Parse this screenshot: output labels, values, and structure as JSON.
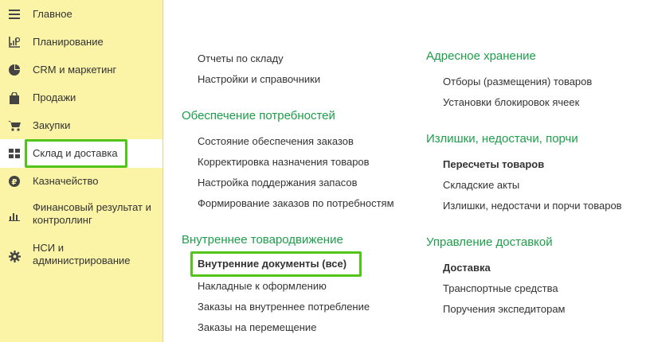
{
  "sidebar": {
    "items": [
      {
        "label": "Главное",
        "icon": "menu-icon"
      },
      {
        "label": "Планирование",
        "icon": "planning-icon"
      },
      {
        "label": "CRM и маркетинг",
        "icon": "pie-chart-icon"
      },
      {
        "label": "Продажи",
        "icon": "shopping-bag-icon"
      },
      {
        "label": "Закупки",
        "icon": "cart-icon"
      },
      {
        "label": "Склад и доставка",
        "icon": "grid-icon"
      },
      {
        "label": "Казначейство",
        "icon": "ruble-icon"
      },
      {
        "label": "Финансовый результат и контроллинг",
        "icon": "bar-chart-icon"
      },
      {
        "label": "НСИ и администрирование",
        "icon": "gear-icon"
      }
    ],
    "active": "Склад и доставка"
  },
  "left_column": {
    "top_links": [
      "Отчеты по складу",
      "Настройки и справочники"
    ],
    "sections": [
      {
        "title": "Обеспечение потребностей",
        "links": [
          "Состояние обеспечения заказов",
          "Корректировка назначения товаров",
          "Настройка поддержания запасов",
          "Формирование заказов по потребностям"
        ]
      },
      {
        "title": "Внутреннее товародвижение",
        "links": [
          "Внутренние документы (все)",
          "Накладные к оформлению",
          "Заказы на внутреннее потребление",
          "Заказы на перемещение"
        ]
      }
    ]
  },
  "right_column": {
    "sections": [
      {
        "title": "Адресное хранение",
        "links": [
          "Отборы (размещения) товаров",
          "Установки блокировок ячеек"
        ]
      },
      {
        "title": "Излишки, недостачи, порчи",
        "links": [
          "Пересчеты товаров",
          "Складские акты",
          "Излишки, недостачи и порчи товаров"
        ]
      },
      {
        "title": "Управление доставкой",
        "links": [
          "Доставка",
          "Транспортные средства",
          "Поручения экспедиторам"
        ]
      }
    ]
  },
  "colors": {
    "sidebar_bg": "#fbf3a6",
    "section_title": "#1d9e4a",
    "highlight": "#52c41a"
  }
}
